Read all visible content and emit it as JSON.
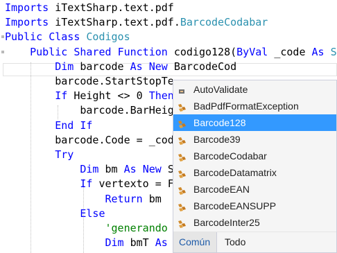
{
  "code": {
    "lines": [
      [
        {
          "t": "Imports ",
          "c": "kw"
        },
        {
          "t": "iTextSharp.text.pdf",
          "c": "pl"
        }
      ],
      [
        {
          "t": "Imports ",
          "c": "kw"
        },
        {
          "t": "iTextSharp.text.pdf.",
          "c": "pl"
        },
        {
          "t": "BarcodeCodabar",
          "c": "ty"
        }
      ],
      [
        {
          "t": "Public ",
          "c": "kw"
        },
        {
          "t": "Class ",
          "c": "kw"
        },
        {
          "t": "Codigos",
          "c": "ty"
        }
      ],
      [
        {
          "t": "    Public ",
          "c": "kw"
        },
        {
          "t": "Shared ",
          "c": "kw"
        },
        {
          "t": "Function ",
          "c": "kw"
        },
        {
          "t": "codigo128(",
          "c": "pl"
        },
        {
          "t": "ByVal ",
          "c": "kw"
        },
        {
          "t": "_code ",
          "c": "pl"
        },
        {
          "t": "As ",
          "c": "kw"
        },
        {
          "t": "St",
          "c": "ty"
        }
      ],
      [
        {
          "t": "        Dim ",
          "c": "kw"
        },
        {
          "t": "barcode ",
          "c": "pl"
        },
        {
          "t": "As ",
          "c": "kw"
        },
        {
          "t": "New ",
          "c": "kw"
        },
        {
          "t": "BarcodeCod",
          "c": "pl"
        }
      ],
      [
        {
          "t": "        barcode.StartStopTe",
          "c": "pl"
        }
      ],
      [
        {
          "t": "        If ",
          "c": "kw"
        },
        {
          "t": "Height <> 0 ",
          "c": "pl"
        },
        {
          "t": "Then",
          "c": "kw"
        }
      ],
      [
        {
          "t": "            barcode.BarHeig",
          "c": "pl"
        }
      ],
      [
        {
          "t": "        End ",
          "c": "kw"
        },
        {
          "t": "If",
          "c": "kw"
        }
      ],
      [
        {
          "t": "        barcode.Code = _cod",
          "c": "pl"
        }
      ],
      [
        {
          "t": "        Try",
          "c": "kw"
        }
      ],
      [
        {
          "t": "            Dim ",
          "c": "kw"
        },
        {
          "t": "bm ",
          "c": "pl"
        },
        {
          "t": "As ",
          "c": "kw"
        },
        {
          "t": "New ",
          "c": "kw"
        },
        {
          "t": "S",
          "c": "pl"
        }
      ],
      [
        {
          "t": "            If ",
          "c": "kw"
        },
        {
          "t": "vertexto = F",
          "c": "pl"
        }
      ],
      [
        {
          "t": "                Return ",
          "c": "kw"
        },
        {
          "t": "bm",
          "c": "pl"
        }
      ],
      [
        {
          "t": "            Else",
          "c": "kw"
        }
      ],
      [
        {
          "t": "                'generando",
          "c": "cm"
        }
      ],
      [
        {
          "t": "                Dim ",
          "c": "kw"
        },
        {
          "t": "bmT ",
          "c": "pl"
        },
        {
          "t": "As",
          "c": "kw"
        }
      ]
    ]
  },
  "intellisense": {
    "items": [
      {
        "label": "AutoValidate",
        "icon": "property-icon",
        "selected": false
      },
      {
        "label": "BadPdfFormatException",
        "icon": "class-icon",
        "selected": false
      },
      {
        "label": "Barcode128",
        "icon": "class-icon",
        "selected": true
      },
      {
        "label": "Barcode39",
        "icon": "class-icon",
        "selected": false
      },
      {
        "label": "BarcodeCodabar",
        "icon": "class-icon",
        "selected": false
      },
      {
        "label": "BarcodeDatamatrix",
        "icon": "class-icon",
        "selected": false
      },
      {
        "label": "BarcodeEAN",
        "icon": "class-icon",
        "selected": false
      },
      {
        "label": "BarcodeEANSUPP",
        "icon": "class-icon",
        "selected": false
      },
      {
        "label": "BarcodeInter25",
        "icon": "class-icon",
        "selected": false
      }
    ],
    "tabs": {
      "common": "Común",
      "all": "Todo"
    }
  },
  "colors": {
    "keyword": "#0000ff",
    "type": "#2b91af",
    "comment": "#008000",
    "selection": "#3399ff"
  }
}
